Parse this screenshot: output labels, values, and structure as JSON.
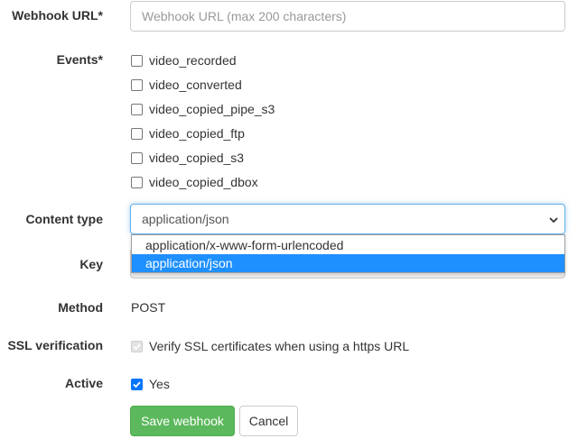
{
  "webhook_url": {
    "label": "Webhook URL*",
    "placeholder": "Webhook URL (max 200 characters)",
    "value": ""
  },
  "events": {
    "label": "Events*",
    "options": [
      {
        "label": "video_recorded",
        "checked": false
      },
      {
        "label": "video_converted",
        "checked": false
      },
      {
        "label": "video_copied_pipe_s3",
        "checked": false
      },
      {
        "label": "video_copied_ftp",
        "checked": false
      },
      {
        "label": "video_copied_s3",
        "checked": false
      },
      {
        "label": "video_copied_dbox",
        "checked": false
      }
    ]
  },
  "content_type": {
    "label": "Content type",
    "selected": "application/json",
    "options": [
      "application/x-www-form-urlencoded",
      "application/json"
    ],
    "highlighted_index": 1
  },
  "key": {
    "label": "Key"
  },
  "method": {
    "label": "Method",
    "value": "POST"
  },
  "ssl_verification": {
    "label": "SSL verification",
    "checkbox_label": "Verify SSL certificates when using a https URL",
    "checked": true,
    "disabled": true
  },
  "active": {
    "label": "Active",
    "checkbox_label": "Yes",
    "checked": true
  },
  "buttons": {
    "save": "Save webhook",
    "cancel": "Cancel"
  },
  "colors": {
    "save_bg": "#5cb85c",
    "checkbox_checked": "#0075ff",
    "dropdown_highlight": "#1e90ff",
    "focus_border": "#66afe9"
  }
}
